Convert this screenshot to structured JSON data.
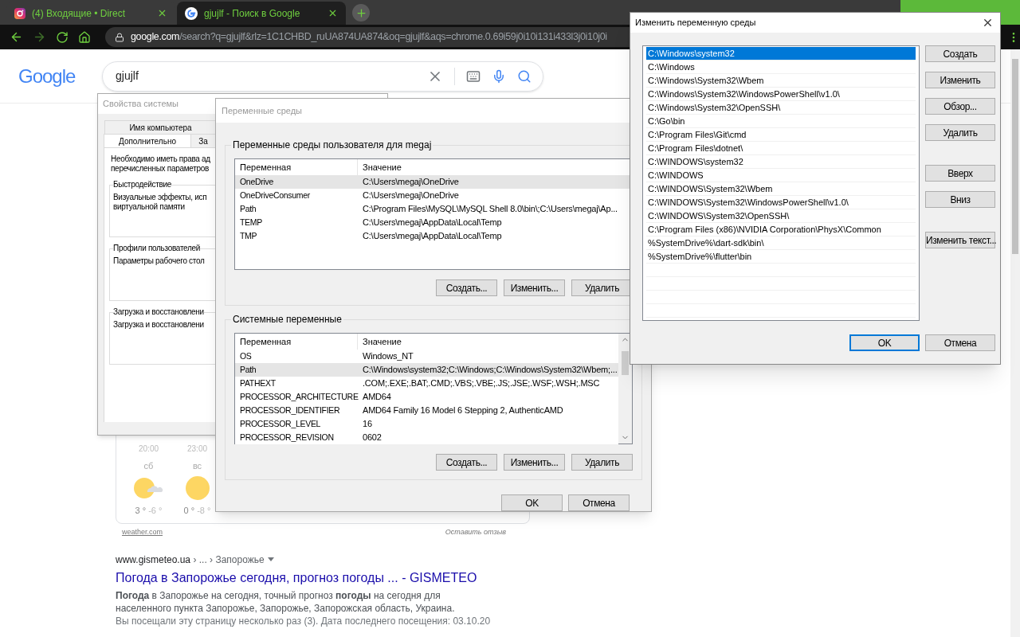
{
  "browser": {
    "tabs": [
      {
        "title": "(4) Входящие • Direct",
        "selected": false,
        "kind": "instagram"
      },
      {
        "title": "gjujlf - Поиск в Google",
        "selected": true,
        "kind": "google"
      }
    ],
    "url_host": "google.com",
    "url_path": "/search?q=gjujlf&rlz=1C1CHBD_ruUA874UA874&oq=gjujlf&aqs=chrome.0.69i59j0i10i131i433l3j0i10j0i",
    "logo": "Google",
    "search_query": "gjujlf",
    "weather": {
      "times": [
        "20:00",
        "23:00"
      ],
      "days": [
        {
          "day": "сб",
          "high": "3 °",
          "low": "-6 °",
          "kind": "partly_cloudy"
        },
        {
          "day": "вс",
          "high": "0 °",
          "low": "-8 °",
          "kind": "sunny"
        }
      ],
      "source": "weather.com",
      "feedback": "Оставить отзыв"
    },
    "result": {
      "site": "www.gismeteo.ua",
      "path": "› ... › Запорожье",
      "title": "Погода в Запорожье сегодня, прогноз погоды ... - GISMETEO",
      "snippet": "**Погода** в Запорожье на сегодня, точный прогноз **погоды** на сегодня для населенного пункта Запорожье, Запорожье, Запорожская область, Украина.",
      "visited": "Вы посещали эту страницу несколько раз (3). Дата последнего посещения: 03.10.20"
    }
  },
  "system_properties": {
    "title": "Свойства системы",
    "tab_rows": [
      [
        {
          "label": "Имя компьютера",
          "selected": false
        }
      ],
      [
        {
          "label": "Дополнительно",
          "selected": true
        },
        {
          "label": "За",
          "selected": false
        }
      ]
    ],
    "intro": [
      "Необходимо иметь права ад",
      "перечисленных параметров"
    ],
    "groups": [
      {
        "title": "Быстродействие",
        "text": [
          "Визуальные эффекты, исп",
          "виртуальной памяти"
        ]
      },
      {
        "title": "Профили пользователей",
        "text": [
          "Параметры рабочего стол"
        ]
      },
      {
        "title": "Загрузка и восстановлени",
        "text": [
          "Загрузка и восстановлени"
        ]
      }
    ]
  },
  "environment_variables": {
    "title": "Переменные среды",
    "sections": [
      {
        "title": "Переменные среды пользователя для megaj",
        "columns": [
          "Переменная",
          "Значение"
        ],
        "rows": [
          {
            "name": "OneDrive",
            "value": "C:\\Users\\megaj\\OneDrive",
            "selected": true
          },
          {
            "name": "OneDriveConsumer",
            "value": "C:\\Users\\megaj\\OneDrive",
            "selected": false
          },
          {
            "name": "Path",
            "value": "C:\\Program Files\\MySQL\\MySQL Shell 8.0\\bin\\;C:\\Users\\megaj\\Ap...",
            "selected": false
          },
          {
            "name": "TEMP",
            "value": "C:\\Users\\megaj\\AppData\\Local\\Temp",
            "selected": false
          },
          {
            "name": "TMP",
            "value": "C:\\Users\\megaj\\AppData\\Local\\Temp",
            "selected": false
          }
        ],
        "buttons": [
          "Создать...",
          "Изменить...",
          "Удалить"
        ]
      },
      {
        "title": "Системные переменные",
        "columns": [
          "Переменная",
          "Значение"
        ],
        "rows": [
          {
            "name": "OS",
            "value": "Windows_NT",
            "selected": false
          },
          {
            "name": "Path",
            "value": "C:\\Windows\\system32;C:\\Windows;C:\\Windows\\System32\\Wbem;...",
            "selected": true
          },
          {
            "name": "PATHEXT",
            "value": ".COM;.EXE;.BAT;.CMD;.VBS;.VBE;.JS;.JSE;.WSF;.WSH;.MSC",
            "selected": false
          },
          {
            "name": "PROCESSOR_ARCHITECTURE",
            "value": "AMD64",
            "selected": false
          },
          {
            "name": "PROCESSOR_IDENTIFIER",
            "value": "AMD64 Family 16 Model 6 Stepping 2, AuthenticAMD",
            "selected": false
          },
          {
            "name": "PROCESSOR_LEVEL",
            "value": "16",
            "selected": false
          },
          {
            "name": "PROCESSOR_REVISION",
            "value": "0602",
            "selected": false
          }
        ],
        "buttons": [
          "Создать...",
          "Изменить...",
          "Удалить"
        ]
      }
    ],
    "footer_buttons": [
      {
        "label": "OK",
        "default": false
      },
      {
        "label": "Отмена",
        "default": false
      }
    ]
  },
  "edit_variable": {
    "title": "Изменить переменную среды",
    "items": [
      {
        "text": "C:\\Windows\\system32",
        "selected": true
      },
      {
        "text": "C:\\Windows",
        "selected": false
      },
      {
        "text": "C:\\Windows\\System32\\Wbem",
        "selected": false
      },
      {
        "text": "C:\\Windows\\System32\\WindowsPowerShell\\v1.0\\",
        "selected": false
      },
      {
        "text": "C:\\Windows\\System32\\OpenSSH\\",
        "selected": false
      },
      {
        "text": "C:\\Go\\bin",
        "selected": false
      },
      {
        "text": "C:\\Program Files\\Git\\cmd",
        "selected": false
      },
      {
        "text": "C:\\Program Files\\dotnet\\",
        "selected": false
      },
      {
        "text": "C:\\WINDOWS\\system32",
        "selected": false
      },
      {
        "text": "C:\\WINDOWS",
        "selected": false
      },
      {
        "text": "C:\\WINDOWS\\System32\\Wbem",
        "selected": false
      },
      {
        "text": "C:\\WINDOWS\\System32\\WindowsPowerShell\\v1.0\\",
        "selected": false
      },
      {
        "text": "C:\\WINDOWS\\System32\\OpenSSH\\",
        "selected": false
      },
      {
        "text": "C:\\Program Files (x86)\\NVIDIA Corporation\\PhysX\\Common",
        "selected": false
      },
      {
        "text": "%SystemDrive%\\dart-sdk\\bin\\",
        "selected": false
      },
      {
        "text": "%SystemDrive%\\flutter\\bin",
        "selected": false
      }
    ],
    "button_groups": [
      [
        "Создать",
        "Изменить",
        "Обзор...",
        "Удалить"
      ],
      [
        "Вверх",
        "Вниз"
      ],
      [
        "Изменить текст..."
      ]
    ],
    "footer_buttons": [
      {
        "label": "OK",
        "default": true
      },
      {
        "label": "Отмена",
        "default": false
      }
    ]
  }
}
